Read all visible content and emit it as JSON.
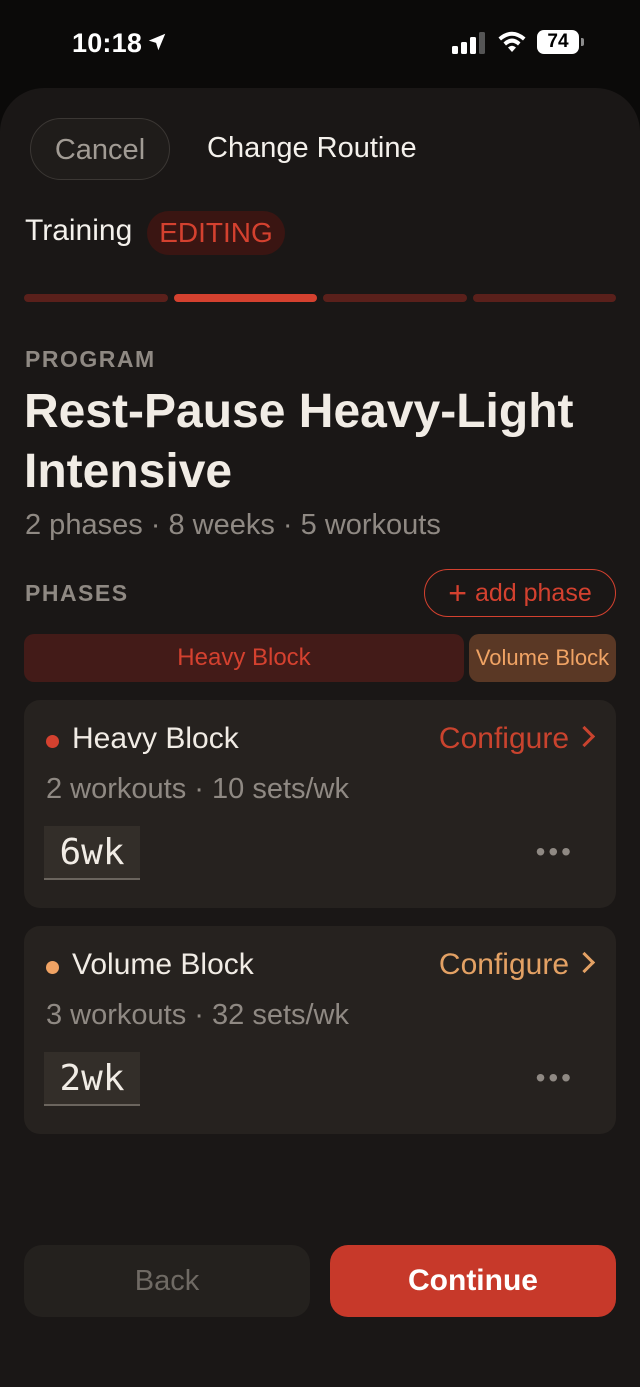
{
  "status_bar": {
    "time": "10:18",
    "battery": "74",
    "icons": [
      "location-arrow-icon",
      "signal-icon",
      "wifi-icon",
      "battery-icon"
    ]
  },
  "header": {
    "cancel_label": "Cancel",
    "title": "Change Routine"
  },
  "mode": {
    "label": "Training",
    "badge": "EDITING"
  },
  "progress": {
    "steps": 4,
    "current": 2
  },
  "program": {
    "section_label": "PROGRAM",
    "name": "Rest-Pause Heavy-Light Intensive",
    "meta": "2 phases · 8 weeks · 5 workouts"
  },
  "phases": {
    "section_label": "PHASES",
    "add_label": "add phase",
    "bar": [
      {
        "label": "Heavy Block",
        "weeks": 6
      },
      {
        "label": "Volume Block",
        "weeks": 2
      }
    ],
    "items": [
      {
        "name": "Heavy Block",
        "configure": "Configure",
        "meta": "2 workouts · 10 sets/wk",
        "weeks": "6wk",
        "more": "•••",
        "color": "#d4412f"
      },
      {
        "name": "Volume Block",
        "configure": "Configure",
        "meta": "3 workouts · 32 sets/wk",
        "weeks": "2wk",
        "more": "•••",
        "color": "#f0a364"
      }
    ]
  },
  "footer": {
    "back_label": "Back",
    "continue_label": "Continue"
  },
  "colors": {
    "accent": "#d4412f",
    "secondary": "#f0a364",
    "background": "#1a1716"
  }
}
